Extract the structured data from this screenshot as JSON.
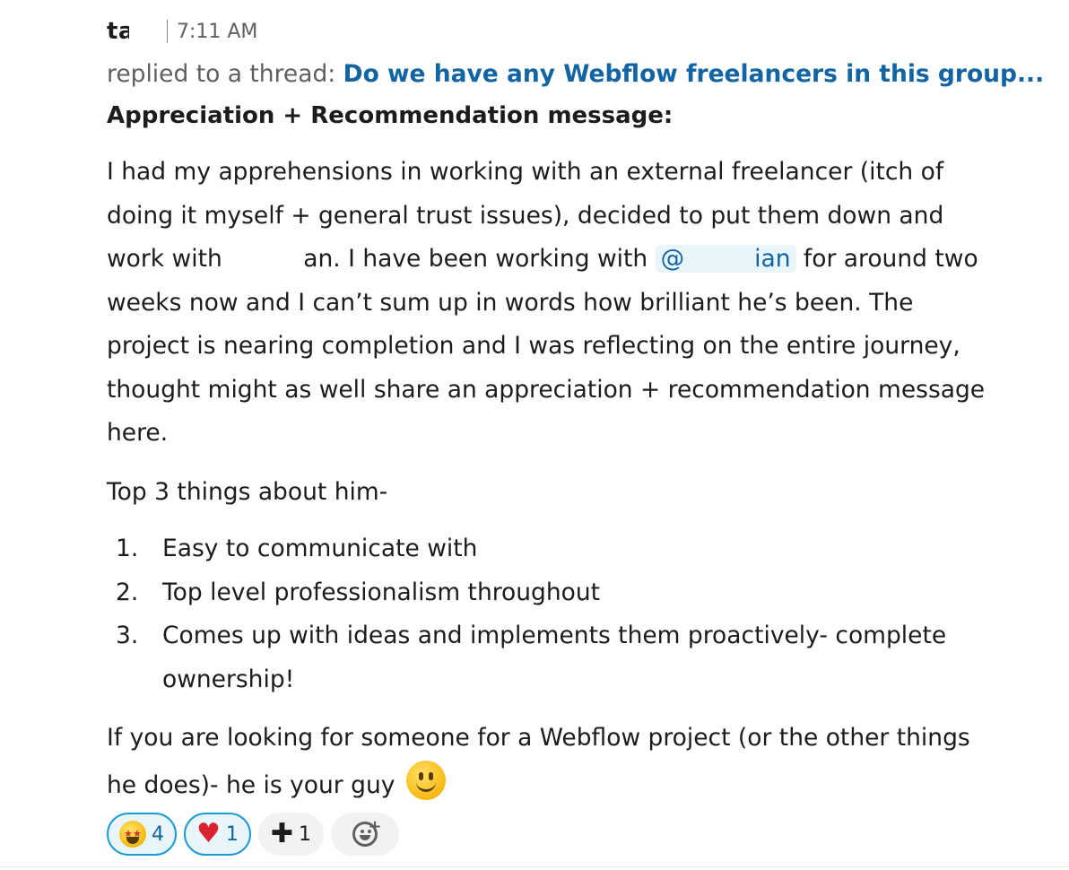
{
  "message": {
    "sender": "ta",
    "timestamp": "7:11 AM",
    "thread_prefix": "replied to a thread: ",
    "thread_title": "Do we have any Webflow freelancers in this group...",
    "heading": "Appreciation + Recommendation message:",
    "p1_lines": [
      "I had my apprehensions in working with an external freelancer (itch of",
      "doing it myself  + general trust issues), decided to put them down and",
      "weeks now and I can’t sum up in words how brilliant he’s been. The",
      "project is nearing completion and I was reflecting on the entire journey,",
      "thought might as well share an appreciation + recommendation message",
      "here."
    ],
    "line3_start": "work with ",
    "line3_mid": "an. I have been working with ",
    "mention_at": "@",
    "mention_end": "ian",
    "line3_end": " for around two",
    "p2": "Top 3 things about him-",
    "list": [
      {
        "num": "1.",
        "text": "Easy to communicate with"
      },
      {
        "num": "2.",
        "text": "Top level professionalism throughout"
      },
      {
        "num": "3.",
        "text": "Comes up with ideas and implements them proactively- complete"
      },
      {
        "num": "",
        "text": "ownership!"
      }
    ],
    "p3_line1": "If you are looking for someone for a Webflow project (or the other things",
    "p3_line2": "he does)- he is your guy "
  },
  "reactions": [
    {
      "icon": "star-struck-emoji-icon",
      "count": "4",
      "active": true
    },
    {
      "icon": "heart-emoji-icon",
      "symbol": "♥",
      "count": "1",
      "active": true
    },
    {
      "icon": "plus-one-emoji-icon",
      "symbol": "✚",
      "count": "1",
      "active": false
    },
    {
      "icon": "add-reaction-icon",
      "active": false
    }
  ],
  "colors": {
    "link": "#1264a3",
    "mention_bg": "#e8f5fa",
    "reaction_active_border": "#1d9bd1",
    "muted_text": "#616061"
  }
}
